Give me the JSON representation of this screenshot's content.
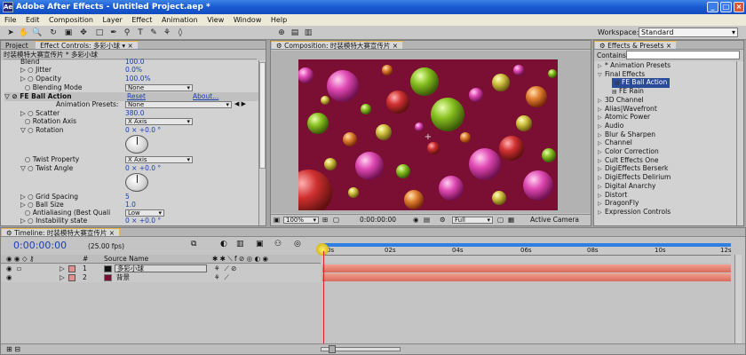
{
  "window": {
    "title": "Adobe After Effects - Untitled Project.aep *",
    "app_icon": "Ae"
  },
  "menu": [
    "File",
    "Edit",
    "Composition",
    "Layer",
    "Effect",
    "Animation",
    "View",
    "Window",
    "Help"
  ],
  "toolbar": {
    "workspace_label": "Workspace:",
    "workspace_value": "Standard"
  },
  "project_panel": {
    "tabs": [
      "Project",
      "Effect Controls: 多彩小球"
    ],
    "header": "时装模特大赛宣传片 * 多彩小球",
    "rows": [
      {
        "label": "Blend",
        "value": "100.0"
      },
      {
        "label": "Jitter",
        "value": "0.0%"
      },
      {
        "label": "Opacity",
        "value": "100.0%"
      },
      {
        "label": "Blending Mode",
        "value": "None"
      },
      {
        "label": "FE Ball Action",
        "reset": "Reset",
        "about": "About..."
      },
      {
        "label": "Animation Presets:",
        "value": "None"
      },
      {
        "label": "Scatter",
        "value": "380.0"
      },
      {
        "label": "Rotation Axis",
        "value": "X Axis"
      },
      {
        "label": "Rotation",
        "value": "0 × +0.0 °"
      },
      {
        "label": "Twist Property",
        "value": "X Axis"
      },
      {
        "label": "Twist Angle",
        "value": "0 × +0.0 °"
      },
      {
        "label": "Grid Spacing",
        "value": "5"
      },
      {
        "label": "Ball Size",
        "value": "1.0"
      },
      {
        "label": "Antialiasing (Best Quali",
        "value": "Low"
      },
      {
        "label": "Instability state",
        "value": "0 × +0.0 °"
      }
    ]
  },
  "comp_panel": {
    "tab": "Composition: 时装模特大赛宣传片",
    "zoom": "100%",
    "timecode": "0:00:00:00",
    "resolution": "Full",
    "camera": "Active Camera",
    "bg_color": "#7a0f33"
  },
  "effects_panel": {
    "tab": "Effects & Presets",
    "contains_label": "Contains:",
    "items": [
      {
        "label": "* Animation Presets",
        "level": 0,
        "open": false
      },
      {
        "label": "Final Effects",
        "level": 0,
        "open": true
      },
      {
        "label": "FE Ball Action",
        "level": 1,
        "selected": true
      },
      {
        "label": "FE Rain",
        "level": 1
      },
      {
        "label": "3D Channel",
        "level": 0
      },
      {
        "label": "Alias|Wavefront",
        "level": 0
      },
      {
        "label": "Atomic Power",
        "level": 0
      },
      {
        "label": "Audio",
        "level": 0
      },
      {
        "label": "Blur & Sharpen",
        "level": 0
      },
      {
        "label": "Channel",
        "level": 0
      },
      {
        "label": "Color Correction",
        "level": 0
      },
      {
        "label": "Cult Effects One",
        "level": 0
      },
      {
        "label": "DigiEffects Berserk",
        "level": 0
      },
      {
        "label": "DigiEffects Delirium",
        "level": 0
      },
      {
        "label": "Digital Anarchy",
        "level": 0
      },
      {
        "label": "Distort",
        "level": 0
      },
      {
        "label": "DragonFly",
        "level": 0
      },
      {
        "label": "Expression Controls",
        "level": 0
      }
    ]
  },
  "timeline": {
    "tab": "Timeline: 时装模特大赛宣传片",
    "timecode": "0:00:00:00",
    "fps": "(25.00 fps)",
    "source_name_header": "Source Name",
    "hash_header": "#",
    "ruler": [
      "0s",
      "02s",
      "04s",
      "06s",
      "08s",
      "10s",
      "12s"
    ],
    "layers": [
      {
        "num": "1",
        "name": "多彩小球",
        "color": "#111111"
      },
      {
        "num": "2",
        "name": "背景",
        "color": "#7a0f33"
      }
    ]
  }
}
